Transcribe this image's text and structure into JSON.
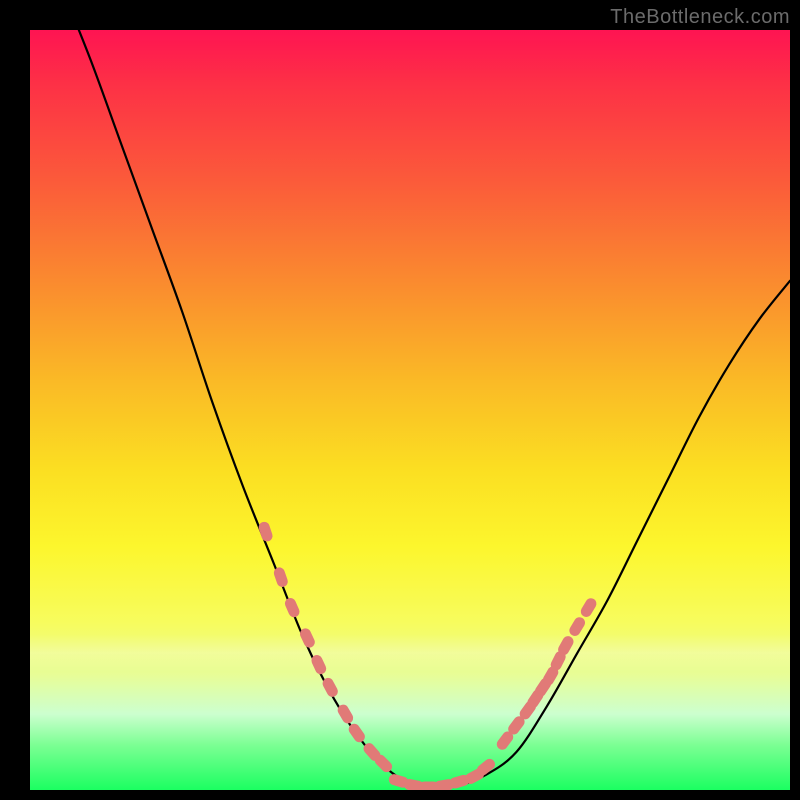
{
  "watermark": "TheBottleneck.com",
  "chart_data": {
    "type": "line",
    "title": "",
    "xlabel": "",
    "ylabel": "",
    "xlim": [
      0,
      1
    ],
    "ylim": [
      0,
      1
    ],
    "grid": false,
    "series": [
      {
        "name": "bottleneck-curve",
        "color": "#000000",
        "x": [
          0.0,
          0.04,
          0.08,
          0.12,
          0.16,
          0.2,
          0.24,
          0.28,
          0.32,
          0.36,
          0.4,
          0.44,
          0.48,
          0.52,
          0.56,
          0.6,
          0.64,
          0.68,
          0.72,
          0.76,
          0.8,
          0.84,
          0.88,
          0.92,
          0.96,
          1.0
        ],
        "values": [
          1.16,
          1.06,
          0.96,
          0.85,
          0.74,
          0.63,
          0.51,
          0.4,
          0.3,
          0.2,
          0.12,
          0.06,
          0.02,
          0.005,
          0.005,
          0.02,
          0.05,
          0.11,
          0.18,
          0.25,
          0.33,
          0.41,
          0.49,
          0.56,
          0.62,
          0.67
        ]
      },
      {
        "name": "highlight-left",
        "color": "#e17a77",
        "x": [
          0.31,
          0.33,
          0.345,
          0.365,
          0.38,
          0.395,
          0.415,
          0.43,
          0.45,
          0.465
        ],
        "values": [
          0.34,
          0.28,
          0.24,
          0.2,
          0.165,
          0.135,
          0.1,
          0.075,
          0.05,
          0.035
        ]
      },
      {
        "name": "highlight-bottom",
        "color": "#e17a77",
        "x": [
          0.485,
          0.505,
          0.525,
          0.545,
          0.565,
          0.585,
          0.6
        ],
        "values": [
          0.012,
          0.006,
          0.004,
          0.006,
          0.011,
          0.018,
          0.03
        ]
      },
      {
        "name": "highlight-right",
        "color": "#e17a77",
        "x": [
          0.625,
          0.64,
          0.655,
          0.665,
          0.675,
          0.685,
          0.695,
          0.705,
          0.72,
          0.735
        ],
        "values": [
          0.065,
          0.085,
          0.105,
          0.12,
          0.135,
          0.15,
          0.17,
          0.19,
          0.215,
          0.24
        ]
      }
    ],
    "gradient_stops": [
      {
        "pos": 0.0,
        "hex": "#fe1452"
      },
      {
        "pos": 0.35,
        "hex": "#fa8a2f"
      },
      {
        "pos": 0.65,
        "hex": "#fcf62d"
      },
      {
        "pos": 0.9,
        "hex": "#ccffcf"
      },
      {
        "pos": 1.0,
        "hex": "#1bff61"
      }
    ],
    "annotations": []
  }
}
